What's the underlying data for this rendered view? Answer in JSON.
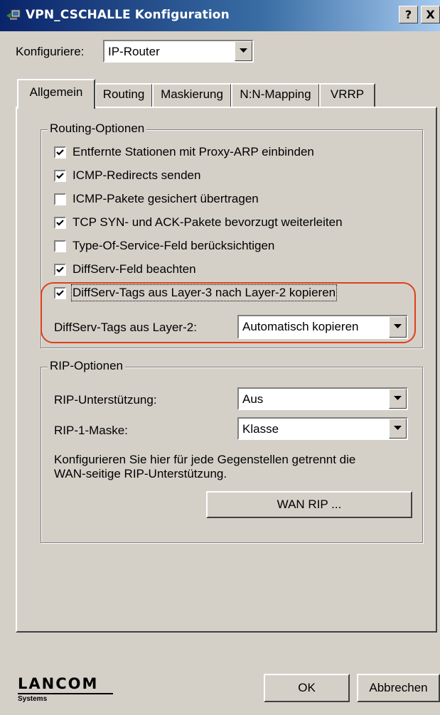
{
  "window": {
    "title": "VPN_CSCHALLE Konfiguration",
    "help_btn": "?",
    "close_btn": "X"
  },
  "config": {
    "label": "Konfiguriere:",
    "selected": "IP-Router"
  },
  "tabs": [
    {
      "label": "Allgemein",
      "active": true
    },
    {
      "label": "Routing",
      "active": false
    },
    {
      "label": "Maskierung",
      "active": false
    },
    {
      "label": "N:N-Mapping",
      "active": false
    },
    {
      "label": "VRRP",
      "active": false
    }
  ],
  "routing_options": {
    "title": "Routing-Optionen",
    "checkboxes": [
      {
        "label": "Entfernte Stationen mit Proxy-ARP einbinden",
        "checked": true
      },
      {
        "label": "ICMP-Redirects senden",
        "checked": true
      },
      {
        "label": "ICMP-Pakete gesichert übertragen",
        "checked": false
      },
      {
        "label": "TCP SYN- und ACK-Pakete bevorzugt weiterleiten",
        "checked": true
      },
      {
        "label": "Type-Of-Service-Feld berücksichtigen",
        "checked": false
      },
      {
        "label": "DiffServ-Feld beachten",
        "checked": true
      },
      {
        "label": "DiffServ-Tags aus Layer-3 nach Layer-2 kopieren",
        "checked": true
      }
    ],
    "diffserv_layer2_label": "DiffServ-Tags aus Layer-2:",
    "diffserv_layer2_value": "Automatisch kopieren"
  },
  "rip_options": {
    "title": "RIP-Optionen",
    "support_label": "RIP-Unterstützung:",
    "support_value": "Aus",
    "mask_label": "RIP-1-Maske:",
    "mask_value": "Klasse",
    "description": "Konfigurieren Sie hier für jede Gegenstellen getrennt die WAN-seitige RIP-Unterstützung.",
    "wan_rip_button": "WAN RIP ..."
  },
  "footer": {
    "logo_main": "LANCOM",
    "logo_sub": "Systems",
    "ok_button": "OK",
    "cancel_button": "Abbrechen"
  },
  "colors": {
    "highlight": "#e0401a",
    "title_bar": "#0a246a",
    "face": "#d4d0c8"
  }
}
